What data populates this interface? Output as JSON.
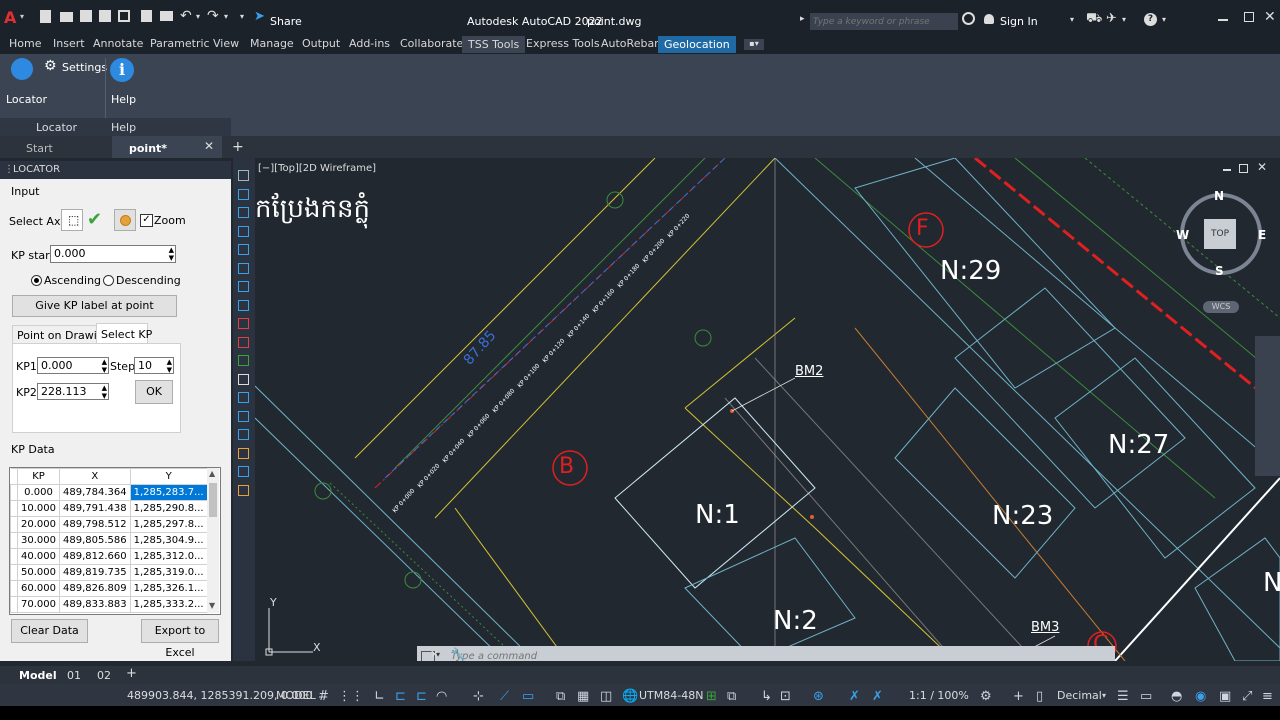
{
  "title_bar": {
    "app_title": "Autodesk AutoCAD 2022",
    "file_name": "point.dwg",
    "share_label": "Share",
    "search_placeholder": "Type a keyword or phrase",
    "sign_in_label": "Sign In"
  },
  "ribbon_tabs": [
    "Home",
    "Insert",
    "Annotate",
    "Parametric",
    "View",
    "Manage",
    "Output",
    "Add-ins",
    "Collaborate",
    "TSS Tools",
    "Express Tools",
    "AutoRebar",
    "Geolocation"
  ],
  "ribbon": {
    "locator_label": "Locator",
    "settings_label": "Settings",
    "help_label": "Help",
    "group_locator": "Locator",
    "group_help": "Help"
  },
  "doc_tabs": {
    "start": "Start",
    "active": "point*"
  },
  "locator": {
    "header": "LOCATOR",
    "input_group": "Input",
    "select_axis_label": "Select Axis:",
    "zoom_label": "Zoom",
    "kp_start_label": "KP start:",
    "kp_start_value": "0.000",
    "ascending_label": "Ascending",
    "descending_label": "Descending",
    "give_kp_button": "Give KP label at point",
    "tab_point_on_drawing": "Point on Drawing",
    "tab_select_kp": "Select KP",
    "kp1_label": "KP1:",
    "kp1_value": "0.000",
    "step_label": "Step:",
    "step_value": "10",
    "kp2_label": "KP2:",
    "kp2_value": "228.113",
    "ok_button": "OK",
    "kp_data_label": "KP Data",
    "columns": [
      "KP",
      "X",
      "Y"
    ],
    "rows": [
      [
        "0.000",
        "489,784.364",
        "1,285,283.7..."
      ],
      [
        "10.000",
        "489,791.438",
        "1,285,290.8..."
      ],
      [
        "20.000",
        "489,798.512",
        "1,285,297.8..."
      ],
      [
        "30.000",
        "489,805.586",
        "1,285,304.9..."
      ],
      [
        "40.000",
        "489,812.660",
        "1,285,312.0..."
      ],
      [
        "50.000",
        "489,819.735",
        "1,285,319.0..."
      ],
      [
        "60.000",
        "489,826.809",
        "1,285,326.1..."
      ],
      [
        "70.000",
        "489,833.883",
        "1,285,333.2..."
      ]
    ],
    "clear_button": "Clear Data",
    "export_button": "Export to Excel"
  },
  "canvas": {
    "viewport_label": "[−][Top][2D Wireframe]",
    "khmer_text": "កប្រែងកនក្លុំ",
    "labels": {
      "n29": "N:29",
      "n27": "N:27",
      "n23": "N:23",
      "n1": "N:1",
      "n2": "N:2",
      "n_cut": "N:",
      "bm2": "BM2",
      "bm3": "BM3",
      "b": "B",
      "f": "F",
      "c": "C",
      "dim": "87.85"
    },
    "viewcube": {
      "top": "TOP",
      "n": "N",
      "s": "S",
      "e": "E",
      "w": "W",
      "wcs": "WCS"
    },
    "command_placeholder": "Type a command",
    "axis_y": "Y",
    "axis_x": "X"
  },
  "layout_tabs": [
    "Model",
    "01",
    "02"
  ],
  "status": {
    "coords": "489903.844, 1285391.209, 0.000",
    "model": "MODEL",
    "crs": "UTM84-48N",
    "scale": "1:1 / 100%",
    "units": "Decimal"
  },
  "colors": {
    "accent": "#1f6aa5",
    "red_line": "#e02020",
    "yellow": "#d4c233",
    "cyan": "#5fd3d3",
    "green": "#3c8c3c"
  }
}
